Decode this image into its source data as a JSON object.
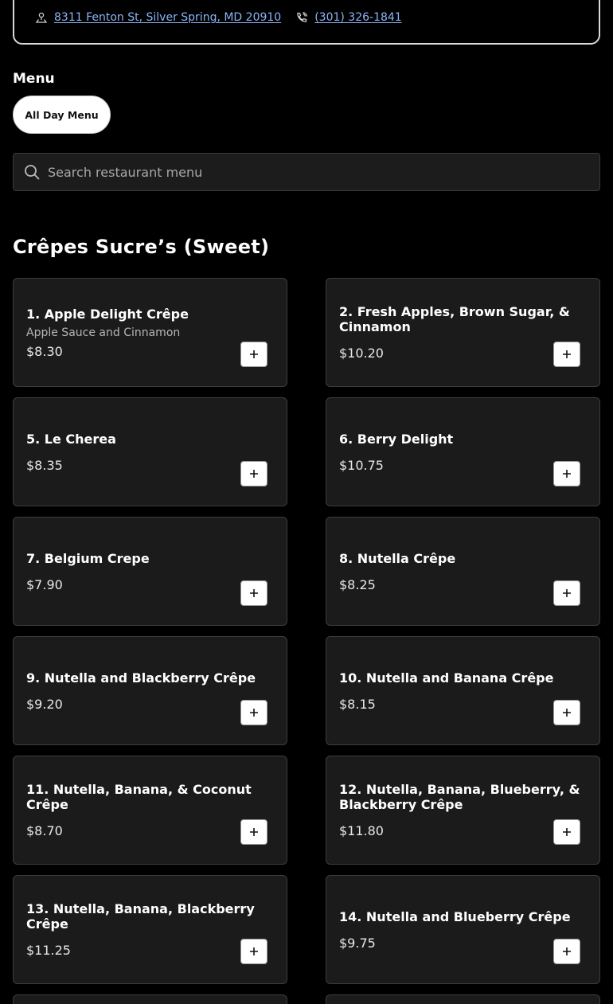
{
  "restaurant": {
    "address": "8311 Fenton St, Silver Spring, MD 20910",
    "phone": "(301) 326-1841"
  },
  "menu": {
    "title": "Menu",
    "tabs": [
      {
        "label": "All Day Menu",
        "selected": true
      }
    ]
  },
  "search": {
    "placeholder": "Search restaurant menu"
  },
  "section": {
    "title": "Crêpes Sucre’s (Sweet)",
    "items": [
      {
        "name": "1. Apple Delight Crêpe",
        "description": "Apple Sauce and Cinnamon",
        "price": "$8.30"
      },
      {
        "name": "2. Fresh Apples, Brown Sugar, & Cinnamon",
        "description": "",
        "price": "$10.20"
      },
      {
        "name": "5. Le Cherea",
        "description": "",
        "price": "$8.35"
      },
      {
        "name": "6. Berry Delight",
        "description": "",
        "price": "$10.75"
      },
      {
        "name": "7. Belgium Crepe",
        "description": "",
        "price": "$7.90"
      },
      {
        "name": "8. Nutella Crêpe",
        "description": "",
        "price": "$8.25"
      },
      {
        "name": "9. Nutella and Blackberry Crêpe",
        "description": "",
        "price": "$9.20"
      },
      {
        "name": "10. Nutella and Banana Crêpe",
        "description": "",
        "price": "$8.15"
      },
      {
        "name": "11. Nutella, Banana, & Coconut Crêpe",
        "description": "",
        "price": "$8.70"
      },
      {
        "name": "12. Nutella, Banana, Blueberry, & Blackberry Crêpe",
        "description": "",
        "price": "$11.80"
      },
      {
        "name": "13. Nutella, Banana, Blackberry Crêpe",
        "description": "",
        "price": "$11.25"
      },
      {
        "name": "14. Nutella and Blueberry Crêpe",
        "description": "",
        "price": "$9.75"
      }
    ]
  },
  "colors": {
    "background": "#000000",
    "card": "#1b1b1b",
    "link": "#8ab4f8"
  }
}
